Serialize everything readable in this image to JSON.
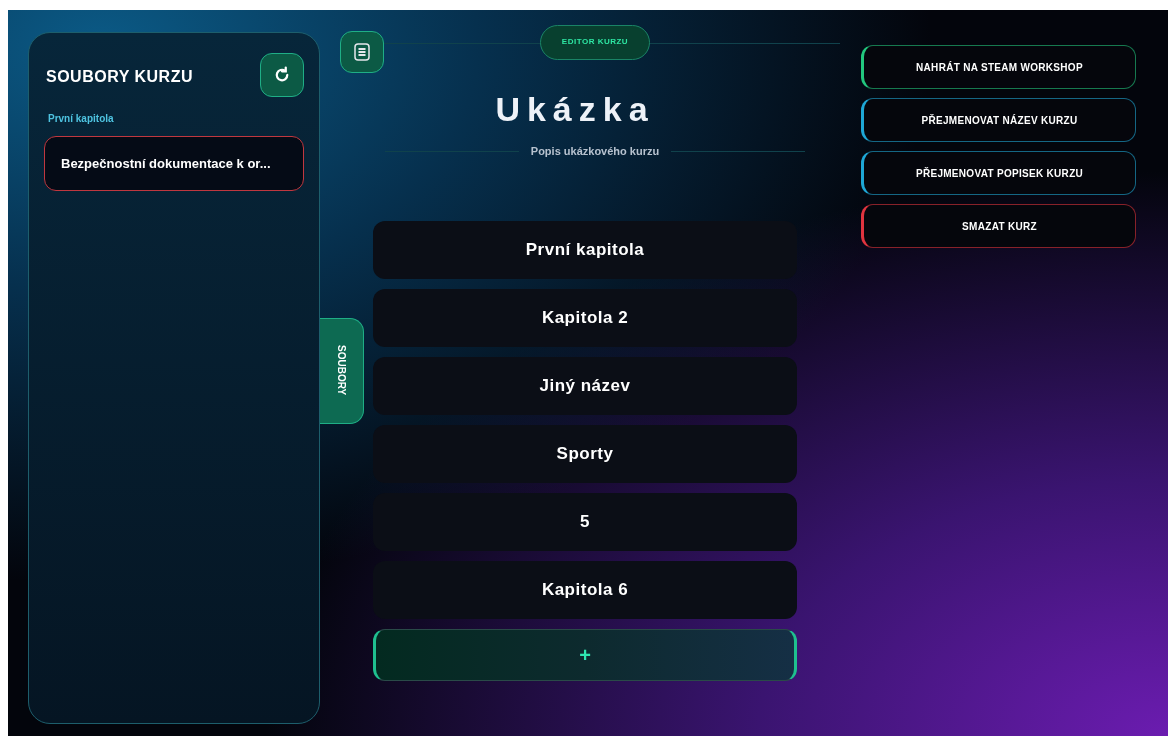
{
  "files_panel": {
    "title": "SOUBORY KURZU",
    "groups": [
      {
        "label": "První kapitola",
        "files": [
          {
            "name": "Bezpečnostní dokumentace k or..."
          }
        ]
      }
    ]
  },
  "side_tab": {
    "label": "SOUBORY"
  },
  "header": {
    "badge": "EDITOR KURZU",
    "title": "Ukázka",
    "subtitle": "Popis ukázkového kurzu"
  },
  "chapters": [
    {
      "label": "První kapitola"
    },
    {
      "label": "Kapitola 2"
    },
    {
      "label": "Jiný název"
    },
    {
      "label": "Sporty"
    },
    {
      "label": "5"
    },
    {
      "label": "Kapitola 6"
    }
  ],
  "add_button": {
    "label": "+"
  },
  "actions": [
    {
      "label": "NAHRÁT NA STEAM WORKSHOP",
      "color": "#22c77e"
    },
    {
      "label": "PŘEJMENOVAT NÁZEV KURZU",
      "color": "#1ea7d6"
    },
    {
      "label": "PŘEJMENOVAT POPISEK KURZU",
      "color": "#1ea7d6"
    },
    {
      "label": "SMAZAT KURZ",
      "color": "#e0343f"
    }
  ]
}
